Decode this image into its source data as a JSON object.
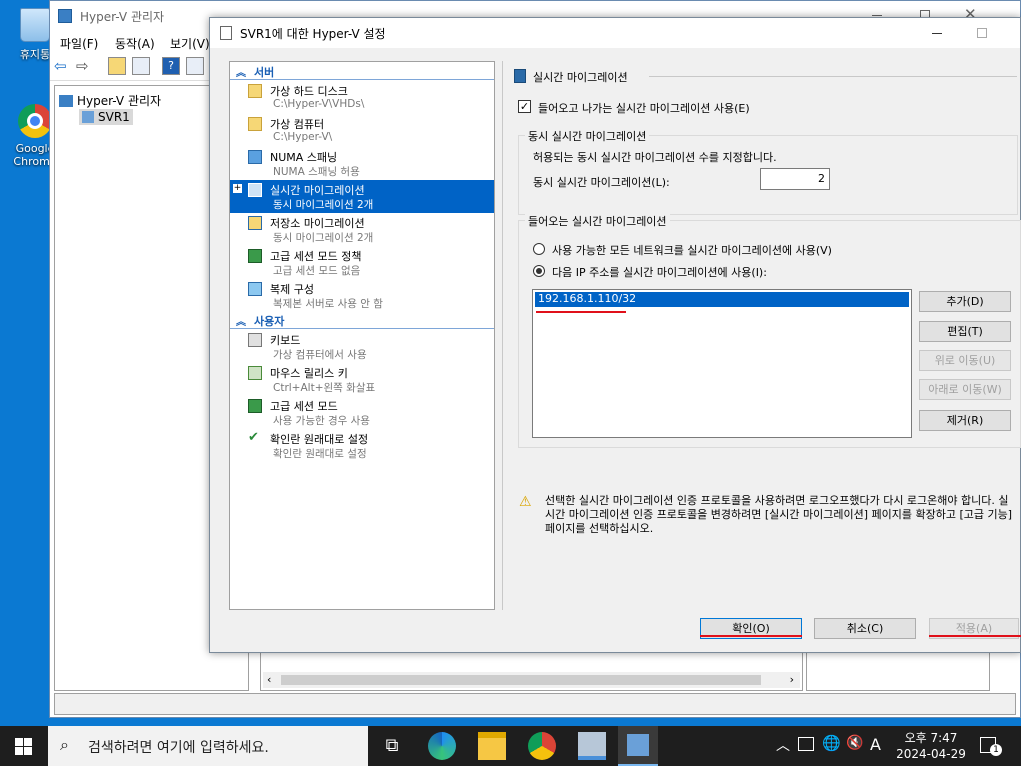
{
  "desktop": {
    "recycle_bin_label": "휴지통",
    "chrome_label": "Google Chrome"
  },
  "manager": {
    "title": "Hyper-V 관리자",
    "menu": [
      "파일(F)",
      "동작(A)",
      "보기(V)"
    ],
    "tree_root": "Hyper-V 관리자",
    "tree_child": "SVR1"
  },
  "dialog": {
    "title": "SVR1에 대한 Hyper-V 설정",
    "section_server": "서버",
    "section_user": "사용자",
    "nav_server": [
      {
        "title": "가상 하드 디스크",
        "sub": "C:\\Hyper-V\\VHDs\\"
      },
      {
        "title": "가상 컴퓨터",
        "sub": "C:\\Hyper-V\\"
      },
      {
        "title": "NUMA 스패닝",
        "sub": "NUMA 스패닝 허용"
      },
      {
        "title": "실시간 마이그레이션",
        "sub": "동시 마이그레이션 2개"
      },
      {
        "title": "저장소 마이그레이션",
        "sub": "동시 마이그레이션 2개"
      },
      {
        "title": "고급 세션 모드 정책",
        "sub": "고급 세션 모드 없음"
      },
      {
        "title": "복제 구성",
        "sub": "복제본 서버로 사용 안 함"
      }
    ],
    "nav_user": [
      {
        "title": "키보드",
        "sub": "가상 컴퓨터에서 사용"
      },
      {
        "title": "마우스 릴리스 키",
        "sub": "Ctrl+Alt+왼쪽 화살표"
      },
      {
        "title": "고급 세션 모드",
        "sub": "사용 가능한 경우 사용"
      },
      {
        "title": "확인란 원래대로 설정",
        "sub": "확인란 원래대로 설정"
      }
    ],
    "panel_title": "실시간 마이그레이션",
    "enable_checkbox_label": "들어오고 나가는 실시간 마이그레이션 사용(E)",
    "enable_checked": true,
    "simultaneous_group": "동시 실시간 마이그레이션",
    "simultaneous_desc": "허용되는 동시 실시간 마이그레이션 수를 지정합니다.",
    "simultaneous_label": "동시 실시간 마이그레이션(L):",
    "simultaneous_value": "2",
    "incoming_group": "들어오는 실시간 마이그레이션",
    "radio_any": "사용 가능한 모든 네트워크를 실시간 마이그레이션에 사용(V)",
    "radio_specific": "다음 IP 주소를 실시간 마이그레이션에 사용(I):",
    "ip_list": [
      "192.168.1.110/32"
    ],
    "buttons": {
      "add": "추가(D)",
      "edit": "편집(T)",
      "up": "위로 이동(U)",
      "down": "아래로 이동(W)",
      "remove": "제거(R)"
    },
    "warning_text": "선택한 실시간 마이그레이션 인증 프로토콜을 사용하려면 로그오프했다가 다시 로그온해야 합니다. 실시간 마이그레이션 인증 프로토콜을 변경하려면 [실시간 마이그레이션] 페이지를 확장하고 [고급 기능] 페이지를 선택하십시오.",
    "ok": "확인(O)",
    "cancel": "취소(C)",
    "apply": "적용(A)"
  },
  "taskbar": {
    "search_placeholder": "검색하려면 여기에 입력하세요.",
    "time": "오후 7:47",
    "date": "2024-04-29",
    "ime": "A",
    "notification_count": "1"
  }
}
